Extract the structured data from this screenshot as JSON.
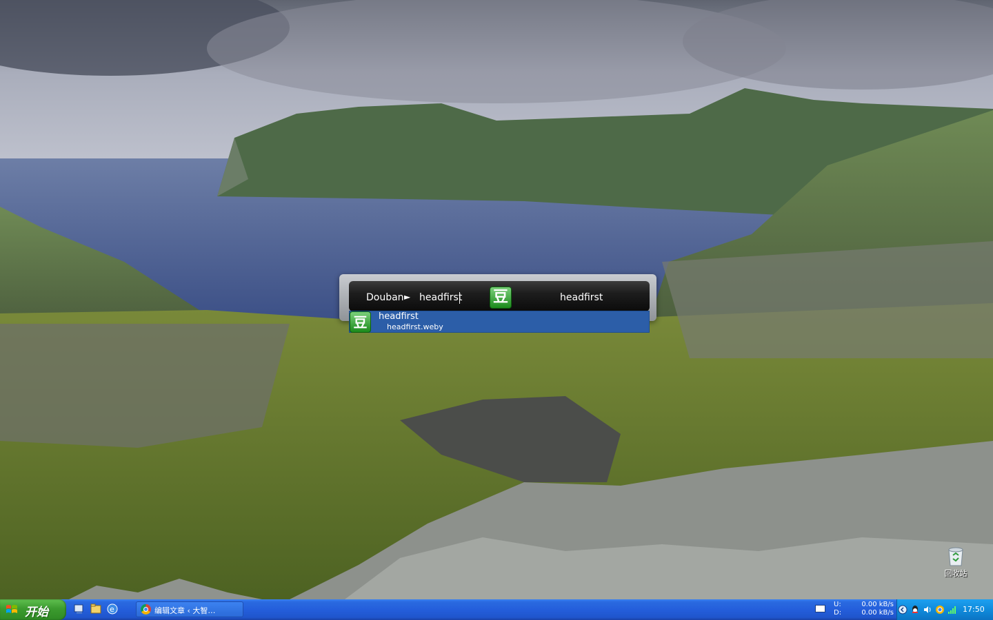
{
  "launcher": {
    "catalog": "Douban",
    "arrow": "►",
    "query": "headfirst",
    "icon_glyph": "豆",
    "result": "headfirst"
  },
  "suggestions": [
    {
      "title": "headfirst",
      "path": "headfirst.weby",
      "icon_glyph": "豆"
    }
  ],
  "desktop": {
    "recycle_bin_label": "回收站"
  },
  "taskbar": {
    "start_label": "开始",
    "task_label": "编辑文章 ‹ 大智…",
    "net_upload_label": "U:",
    "net_download_label": "D:",
    "net_upload_value": "0.00 kB/s",
    "net_download_value": "0.00 kB/s",
    "clock": "17:50"
  },
  "icons": {
    "quick_launch": [
      "show-desktop-icon",
      "file-manager-icon",
      "ie-icon"
    ],
    "tray": [
      "expand-tray-icon",
      "qq-icon",
      "volume-icon",
      "chrome-tray-icon",
      "signal-icon"
    ]
  }
}
